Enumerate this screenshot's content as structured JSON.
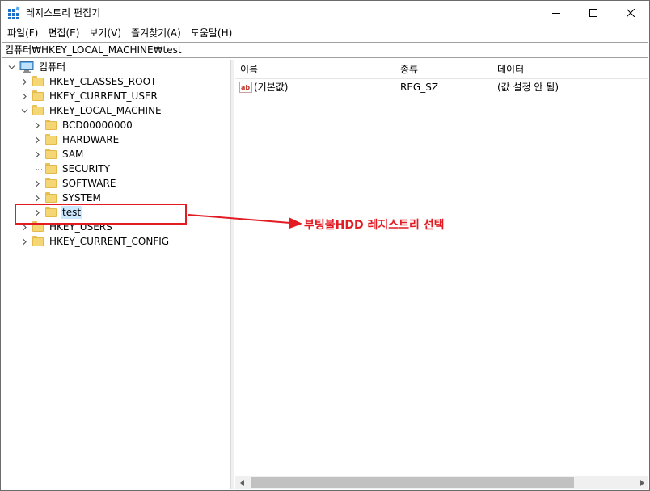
{
  "window": {
    "title": "레지스트리 편집기"
  },
  "menubar": {
    "items": [
      "파일(F)",
      "편집(E)",
      "보기(V)",
      "즐겨찾기(A)",
      "도움말(H)"
    ]
  },
  "address": {
    "path": "컴퓨터₩HKEY_LOCAL_MACHINE₩test"
  },
  "tree": {
    "root": "컴퓨터",
    "hives": [
      "HKEY_CLASSES_ROOT",
      "HKEY_CURRENT_USER",
      "HKEY_LOCAL_MACHINE",
      "HKEY_USERS",
      "HKEY_CURRENT_CONFIG"
    ],
    "local_machine_children": [
      "BCD00000000",
      "HARDWARE",
      "SAM",
      "SECURITY",
      "SOFTWARE",
      "SYSTEM",
      "test"
    ],
    "selected": "test"
  },
  "list": {
    "columns": [
      "이름",
      "종류",
      "데이터"
    ],
    "rows": [
      {
        "name": "(기본값)",
        "type": "REG_SZ",
        "data": "(값 설정 안 됨)",
        "icon": "string-value-icon"
      }
    ]
  },
  "annotation": {
    "text": "부팅불HDD 레지스트리 선택",
    "color": "#e31b23"
  },
  "colors": {
    "selection": "#cce8ff",
    "folder": "#f5d675"
  }
}
